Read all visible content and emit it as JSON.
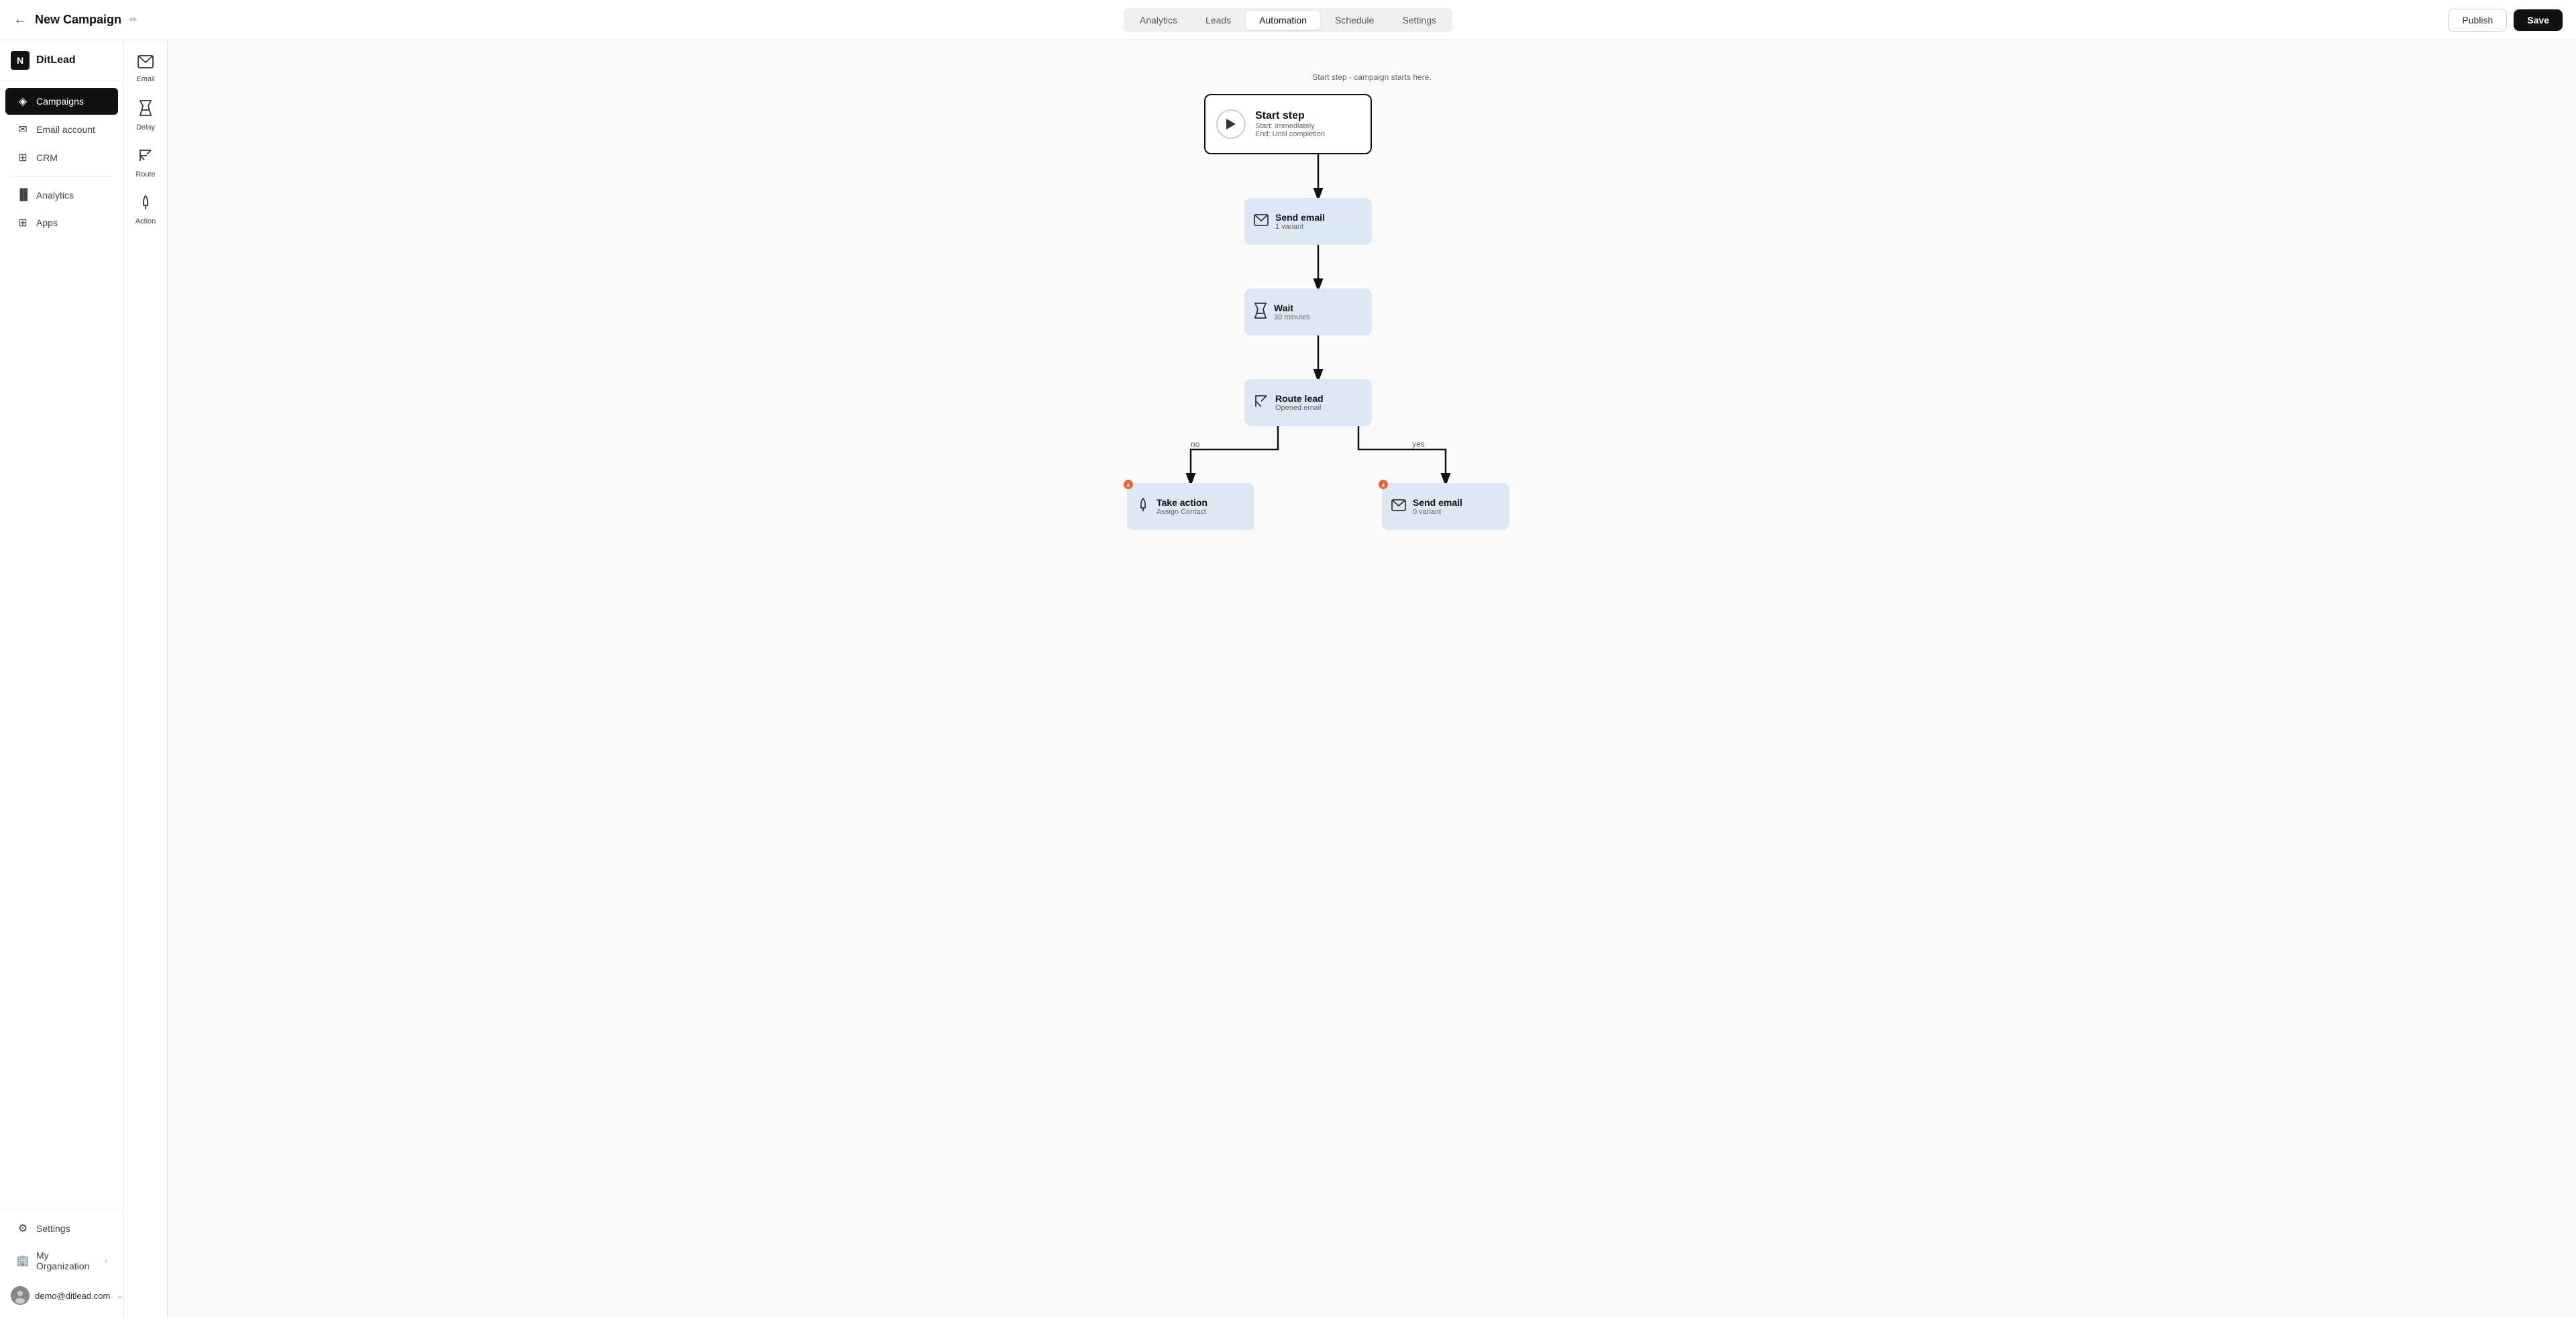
{
  "brand": {
    "icon": "N",
    "name": "DitLead"
  },
  "topbar": {
    "back_icon": "←",
    "campaign_title": "New Campaign",
    "edit_icon": "✏",
    "tabs": [
      {
        "label": "Analytics",
        "active": false
      },
      {
        "label": "Leads",
        "active": false
      },
      {
        "label": "Automation",
        "active": true
      },
      {
        "label": "Schedule",
        "active": false
      },
      {
        "label": "Settings",
        "active": false
      }
    ],
    "publish_label": "Publish",
    "save_label": "Save"
  },
  "sidebar": {
    "nav_items": [
      {
        "label": "Campaigns",
        "active": true,
        "icon": "◈"
      },
      {
        "label": "Email account",
        "active": false,
        "icon": "✉"
      },
      {
        "label": "CRM",
        "active": false,
        "icon": "⊞"
      }
    ],
    "nav_items2": [
      {
        "label": "Analytics",
        "active": false,
        "icon": "▐"
      },
      {
        "label": "Apps",
        "active": false,
        "icon": "⊞"
      }
    ],
    "bottom": [
      {
        "label": "Settings",
        "icon": "⚙"
      },
      {
        "label": "My Organization",
        "icon": "🏢"
      }
    ],
    "user_email": "demo@ditlead.com"
  },
  "tools": [
    {
      "label": "Email",
      "icon": "✉"
    },
    {
      "label": "Delay",
      "icon": "⌛"
    },
    {
      "label": "Route",
      "icon": "⤢"
    },
    {
      "label": "Action",
      "icon": "☝"
    }
  ],
  "canvas": {
    "start_label": "Start step - campaign starts here.",
    "nodes": {
      "start": {
        "title": "Start step",
        "sub1": "Start: Immediately",
        "sub2": "End: Until completion"
      },
      "send_email_1": {
        "title": "Send email",
        "sub": "1 variant"
      },
      "wait": {
        "title": "Wait",
        "sub": "30 minutes"
      },
      "route": {
        "title": "Route lead",
        "sub": "Opened email"
      },
      "take_action": {
        "title": "Take action",
        "sub": "Assign Contact"
      },
      "send_email_2": {
        "title": "Send email",
        "sub": "0 variant"
      }
    },
    "branch_no": "no",
    "branch_yes": "yes"
  }
}
